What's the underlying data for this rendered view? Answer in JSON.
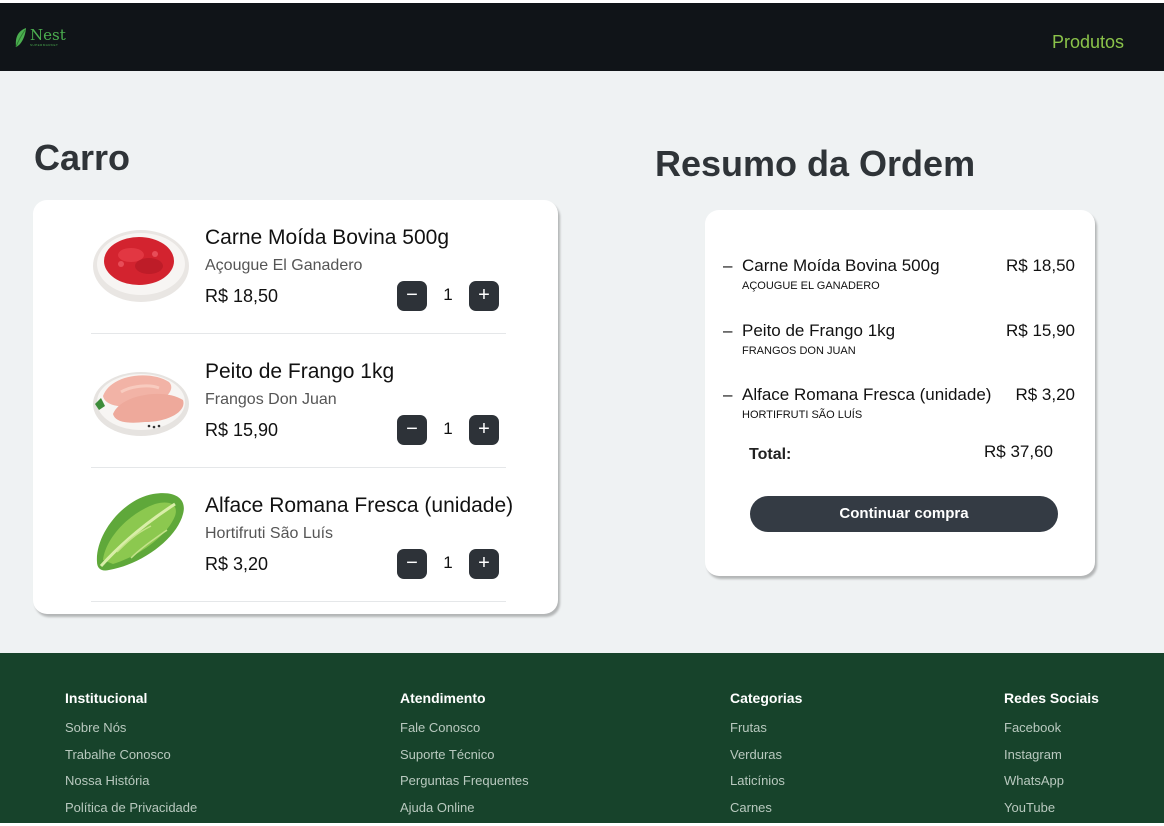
{
  "header": {
    "logo_name": "Nest",
    "logo_sub": "SUPERMARKET",
    "nav_link": "Produtos"
  },
  "cart": {
    "title": "Carro",
    "items": [
      {
        "name": "Carne Moída Bovina 500g",
        "store": "Açougue El Ganadero",
        "price": "R$ 18,50",
        "qty": "1",
        "image": "ground-beef"
      },
      {
        "name": "Peito de Frango 1kg",
        "store": "Frangos Don Juan",
        "price": "R$ 15,90",
        "qty": "1",
        "image": "chicken-breast"
      },
      {
        "name": "Alface Romana Fresca (unidade)",
        "store": "Hortifruti São Luís",
        "price": "R$ 3,20",
        "qty": "1",
        "image": "romaine-lettuce"
      }
    ],
    "minus_symbol": "−",
    "plus_symbol": "+"
  },
  "summary": {
    "title": "Resumo da Ordem",
    "dash": "–",
    "items": [
      {
        "name": "Carne Moída Bovina 500g",
        "store": "Açougue El Ganadero",
        "price": "R$ 18,50"
      },
      {
        "name": "Peito de Frango 1kg",
        "store": "Frangos Don Juan",
        "price": "R$ 15,90"
      },
      {
        "name": "Alface Romana Fresca (unidade)",
        "store": "Hortifruti São Luís",
        "price": "R$ 3,20"
      }
    ],
    "total_label": "Total:",
    "total_value": "R$ 37,60",
    "continue_label": "Continuar compra"
  },
  "footer": {
    "columns": [
      {
        "heading": "Institucional",
        "links": [
          "Sobre Nós",
          "Trabalhe Conosco",
          "Nossa História",
          "Política de Privacidade"
        ]
      },
      {
        "heading": "Atendimento",
        "links": [
          "Fale Conosco",
          "Suporte Técnico",
          "Perguntas Frequentes",
          "Ajuda Online"
        ]
      },
      {
        "heading": "Categorias",
        "links": [
          "Frutas",
          "Verduras",
          "Laticínios",
          "Carnes"
        ]
      },
      {
        "heading": "Redes Sociais",
        "links": [
          "Facebook",
          "Instagram",
          "WhatsApp",
          "YouTube"
        ]
      }
    ]
  },
  "colors": {
    "topbar": "#101418",
    "accent_green": "#8bc34a",
    "background": "#eff2f3",
    "button_dark": "#343b44",
    "footer": "#17432b"
  }
}
